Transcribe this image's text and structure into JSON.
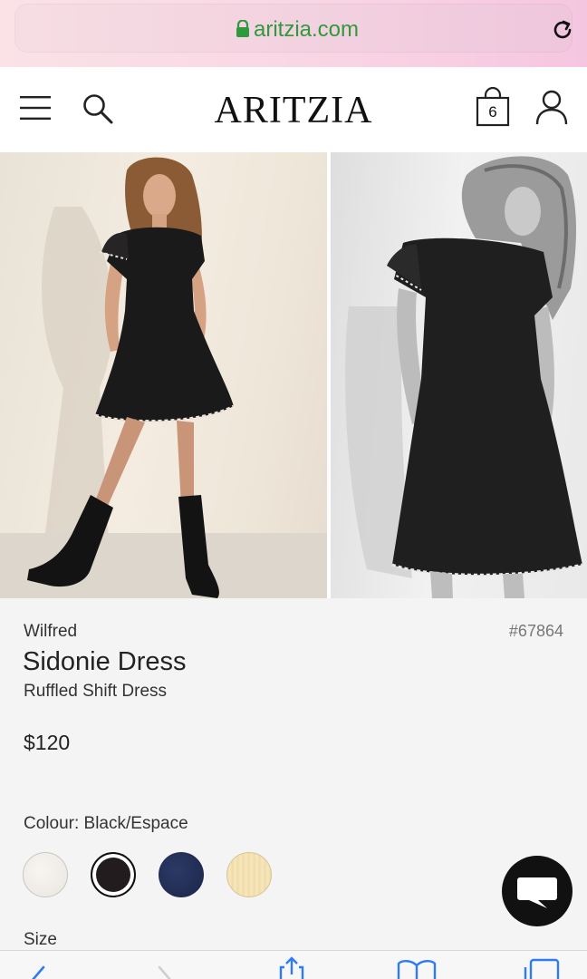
{
  "browser": {
    "url": "aritzia.com",
    "lock_icon": "lock-icon",
    "reload_icon": "reload-icon"
  },
  "header": {
    "logo": "ARITZIA",
    "bag_count": "6",
    "icons": [
      "menu-icon",
      "search-icon",
      "shopping-bag-icon",
      "account-icon"
    ]
  },
  "product": {
    "brand": "Wilfred",
    "sku": "#67864",
    "title": "Sidonie Dress",
    "subtitle": "Ruffled Shift Dress",
    "price": "$120",
    "colour_label": "Colour: Black/Espace",
    "swatches": [
      {
        "name": "ivory",
        "color": "#f1eee9"
      },
      {
        "name": "black",
        "color": "#221c1e",
        "selected": true
      },
      {
        "name": "navy",
        "color": "#22305a"
      },
      {
        "name": "pale-yellow",
        "color": "#f3e1b2"
      }
    ],
    "size_label": "Size"
  },
  "toolbar": {
    "icons": [
      "back-icon",
      "forward-icon",
      "share-icon",
      "bookmarks-icon",
      "tabs-icon"
    ],
    "accent": "#2f7bf6"
  },
  "chat": {
    "icon": "chat-icon"
  }
}
